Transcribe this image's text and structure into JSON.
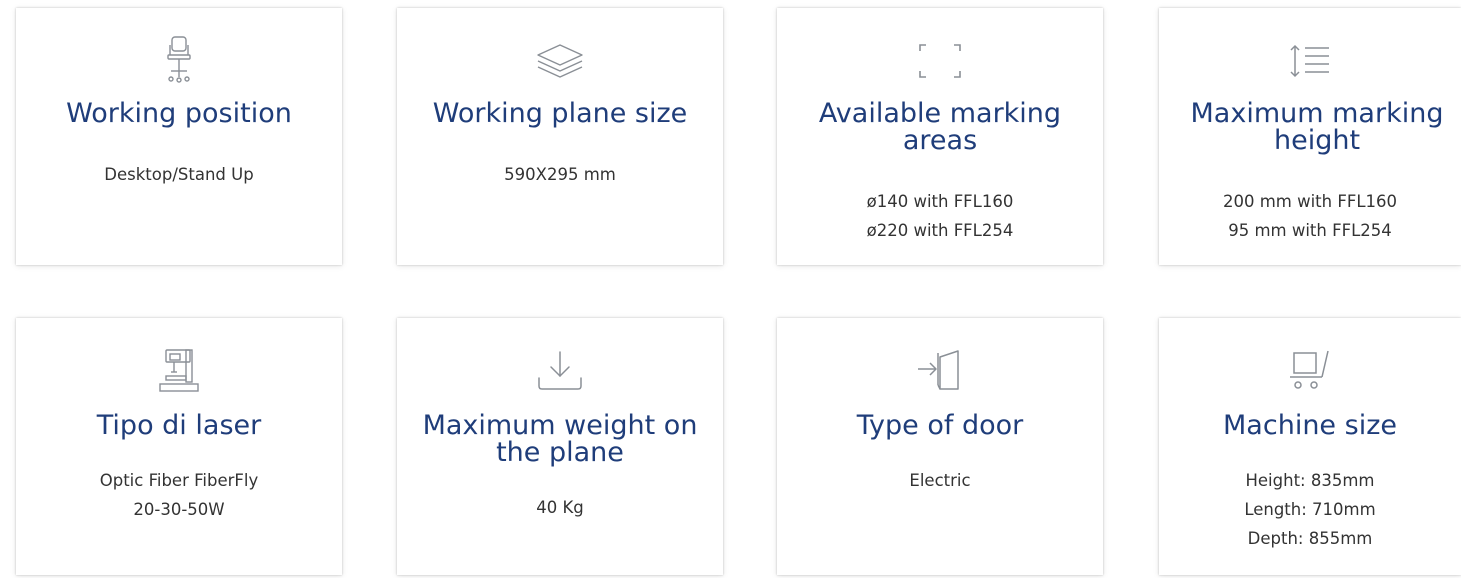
{
  "colors": {
    "title": "#1f3d7a",
    "text": "#333333",
    "icon": "#8a8f96",
    "card_bg": "#ffffff"
  },
  "cards": [
    {
      "icon": "chair-icon",
      "title": "Working position",
      "values": [
        "Desktop/Stand Up"
      ]
    },
    {
      "icon": "layers-icon",
      "title": "Working plane size",
      "values": [
        "590X295 mm"
      ]
    },
    {
      "icon": "marking-area-corners-icon",
      "title": "Available marking areas",
      "values": [
        "ø140 with FFL160",
        "ø220 with FFL254"
      ]
    },
    {
      "icon": "line-height-icon",
      "title": "Maximum marking height",
      "values": [
        "200 mm with FFL160",
        "95 mm with FFL254"
      ]
    },
    {
      "icon": "laser-machine-icon",
      "title": "Tipo di laser",
      "values": [
        "Optic Fiber FiberFly",
        "20-30-50W"
      ]
    },
    {
      "icon": "weight-download-icon",
      "title": "Maximum weight on the plane",
      "values": [
        "40 Kg"
      ]
    },
    {
      "icon": "door-enter-icon",
      "title": "Type of door",
      "values": [
        "Electric"
      ]
    },
    {
      "icon": "cart-icon",
      "title": "Machine size",
      "values": [
        "Height: 835mm",
        "Length: 710mm",
        "Depth: 855mm"
      ]
    }
  ]
}
